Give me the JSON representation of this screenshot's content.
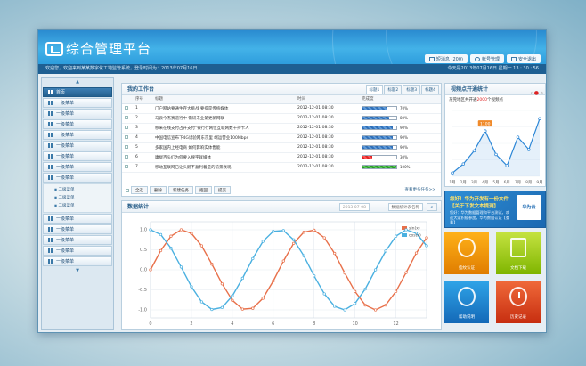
{
  "app": {
    "title": "综合管理平台"
  },
  "header": {
    "buttons": [
      {
        "label": "短消息 (200)",
        "icon": "mail-icon"
      },
      {
        "label": "帐号管理",
        "icon": "gear-icon"
      },
      {
        "label": "安全退出",
        "icon": "exit-icon"
      }
    ]
  },
  "infobar": {
    "left": "欢迎您，欢迎来到某某数字化工地监管系统，登录时间为：2013年07月16日",
    "right": "今天是2013年07月16日   星期一   13 : 30 : 56"
  },
  "sidebar": {
    "up_arrow": "▲",
    "down_arrow": "▼",
    "items_top": [
      "首页",
      "一级菜单",
      "一级菜单",
      "一级菜单",
      "一级菜单",
      "一级菜单",
      "一级菜单",
      "一级菜单",
      "一级菜单"
    ],
    "sub_items": [
      "二级菜单",
      "二级菜单",
      "二级菜单"
    ],
    "items_bottom": [
      "一级菜单",
      "一级菜单",
      "一级菜单",
      "一级菜单",
      "一级菜单"
    ]
  },
  "workpanel": {
    "title": "我的工作台",
    "tabs": [
      "标题1",
      "标题2",
      "标题3",
      "标题4"
    ],
    "columns": [
      "序号",
      "标题",
      "时间",
      "完成度"
    ],
    "rows": [
      {
        "no": "1",
        "title": "门户网站要通生存大挑战 要提是传统媒体",
        "time": "2012-12-01 08:30",
        "pct": "70%",
        "value": 0.7,
        "color": "blue"
      },
      {
        "no": "2",
        "title": "马云今杰赛道行中 需研未业第更新网联",
        "time": "2012-12-01 08:30",
        "pct": "80%",
        "value": 0.8,
        "color": "blue"
      },
      {
        "no": "3",
        "title": "移来在线支付占开支付\"银行行网位互联网数十持卡人",
        "time": "2012-12-01 08:30",
        "pct": "90%",
        "value": 0.9,
        "color": "blue"
      },
      {
        "no": "4",
        "title": "中国电信宣布下4G试验网东京里 端运营业100Mbps",
        "time": "2012-12-01 08:30",
        "pct": "90%",
        "value": 0.9,
        "color": "blue"
      },
      {
        "no": "5",
        "title": "多家国内上经电商 如何影响实体售能",
        "time": "2012-12-01 08:30",
        "pct": "90%",
        "value": 0.9,
        "color": "blue"
      },
      {
        "no": "6",
        "title": "康缇百头们为何要入搜字就媒体",
        "time": "2012-12-01 08:30",
        "pct": "30%",
        "value": 0.3,
        "color": "red"
      },
      {
        "no": "7",
        "title": "移动互联网已让头鹅不盈利着是的前景衰现",
        "time": "2012-12-01 08:30",
        "pct": "100%",
        "value": 1.0,
        "color": "green"
      }
    ],
    "actions": [
      "全选",
      "删除",
      "新建任务",
      "拒回",
      "提交"
    ],
    "more": "查看更多任务>>"
  },
  "stats": {
    "title": "数据统计",
    "date_value": "2013-07-08",
    "select_value": "数据统计表名称",
    "chart_data": {
      "type": "line",
      "x": [
        0,
        0.5,
        1,
        1.5,
        2,
        2.5,
        3,
        3.5,
        4,
        4.5,
        5,
        5.5,
        6,
        6.5,
        7,
        7.5,
        8,
        8.5,
        9,
        9.5,
        10,
        10.5,
        11,
        11.5,
        12,
        12.5,
        13,
        13.5
      ],
      "xticks": [
        "0",
        "2",
        "4",
        "6",
        "8",
        "10",
        "12"
      ],
      "yticks": [
        "1.0",
        "0.5",
        "0.0",
        "-0.5",
        "-1.0"
      ],
      "xlim": [
        0,
        13.5
      ],
      "ylim": [
        -1.2,
        1.2
      ],
      "series": [
        {
          "name": "sin(x)",
          "color": "#e8704a",
          "values": [
            0,
            0.48,
            0.84,
            1.0,
            0.91,
            0.6,
            0.14,
            -0.35,
            -0.76,
            -0.98,
            -0.96,
            -0.71,
            -0.28,
            0.22,
            0.66,
            0.94,
            0.99,
            0.8,
            0.41,
            -0.08,
            -0.54,
            -0.88,
            -1.0,
            -0.88,
            -0.54,
            -0.07,
            0.42,
            0.8
          ]
        },
        {
          "name": "cos(x)",
          "color": "#4ab0e0",
          "values": [
            1.0,
            0.88,
            0.54,
            0.07,
            -0.42,
            -0.8,
            -0.99,
            -0.94,
            -0.65,
            -0.21,
            0.28,
            0.71,
            0.96,
            0.98,
            0.75,
            0.35,
            -0.15,
            -0.6,
            -0.91,
            -1.0,
            -0.84,
            -0.48,
            0.0,
            0.47,
            0.84,
            1.0,
            0.91,
            0.6
          ]
        }
      ]
    }
  },
  "online": {
    "title": "视频点开通统计",
    "sub_prefix": "东莞地区共开通",
    "sub_count": "2000",
    "sub_suffix": "个视频点",
    "chart_data": {
      "type": "line",
      "categories": [
        "1月",
        "2月",
        "3月",
        "4月",
        "5月",
        "6月",
        "7月",
        "8月",
        "9月"
      ],
      "values": [
        80,
        300,
        620,
        1100,
        530,
        260,
        950,
        650,
        1400
      ],
      "ylim": [
        0,
        1600
      ],
      "callout": "1100",
      "color": "#2b86d6"
    }
  },
  "ad": {
    "line1": "您好！华为开发有一份文件",
    "line2": "【关于下发文本提测】",
    "body": "您好：华为数据管理和平台测试，欢迎大家积极参加，华为数据认证【查看】",
    "logo": "华为云"
  },
  "tiles": [
    {
      "label": "指纹认证",
      "icon": "fingerprint-icon"
    },
    {
      "label": "文档下载",
      "icon": "document-icon"
    },
    {
      "label": "帮助说明",
      "icon": "help-icon"
    },
    {
      "label": "历史记录",
      "icon": "history-icon"
    }
  ]
}
